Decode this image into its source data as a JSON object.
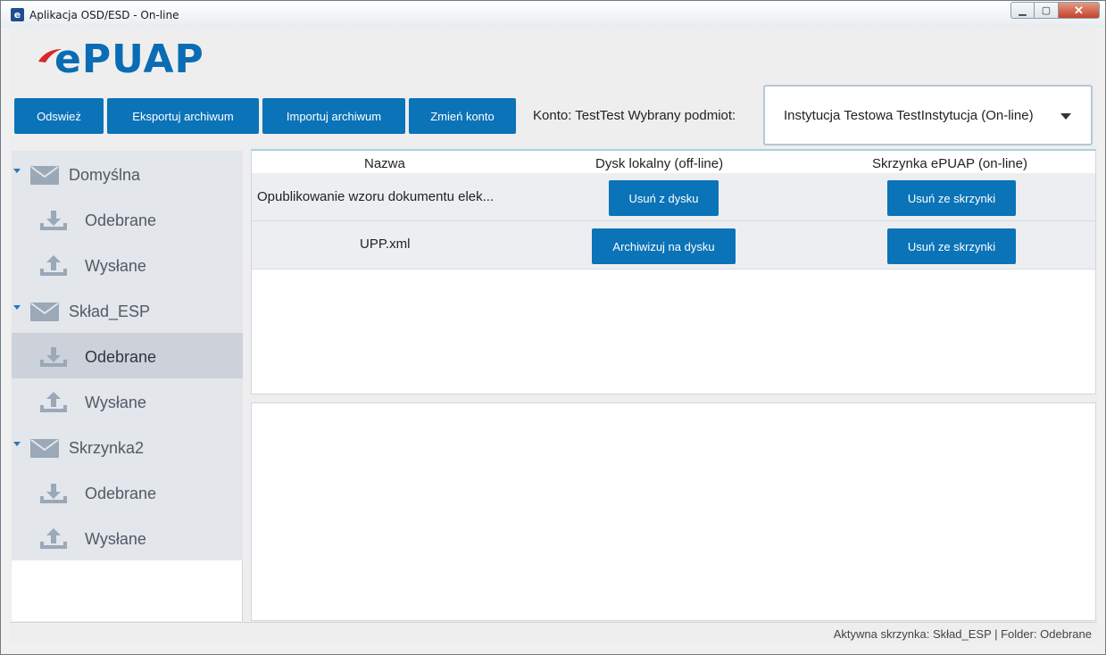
{
  "window": {
    "title": "Aplikacja OSD/ESD - On-line",
    "app_icon": "e"
  },
  "logo": {
    "text": "ePUAP"
  },
  "toolbar": {
    "refresh_label": "Odswież",
    "export_label": "Eksportuj archiwum",
    "import_label": "Importuj archiwum",
    "change_account_label": "Zmień konto",
    "account_info": "Konto: TestTest Wybrany podmiot:",
    "entity_selected": "Instytucja Testowa  TestInstytucja (On-line)"
  },
  "sidebar": {
    "mailboxes": [
      {
        "name": "Domyślna",
        "folders": [
          "Odebrane",
          "Wysłane"
        ]
      },
      {
        "name": "Skład_ESP",
        "folders": [
          "Odebrane",
          "Wysłane"
        ]
      },
      {
        "name": "Skrzynka2",
        "folders": [
          "Odebrane",
          "Wysłane"
        ]
      }
    ],
    "selected": "Skład_ESP / Odebrane"
  },
  "table": {
    "headers": [
      "Nazwa",
      "Dysk lokalny (off-line)",
      "Skrzynka ePUAP (on-line)"
    ],
    "rows": [
      {
        "name": "Opublikowanie wzoru dokumentu elek...",
        "local_action": "Usuń z dysku",
        "remote_action": "Usuń ze skrzynki"
      },
      {
        "name": "UPP.xml",
        "local_action": "Archiwizuj na dysku",
        "remote_action": "Usuń ze skrzynki"
      }
    ]
  },
  "status": {
    "text": "Aktywna skrzynka: Skład_ESP | Folder: Odebrane"
  },
  "colors": {
    "accent": "#0b73b8",
    "sidebar_bg": "#e3e6ea",
    "selected_bg": "#cdd2da"
  }
}
